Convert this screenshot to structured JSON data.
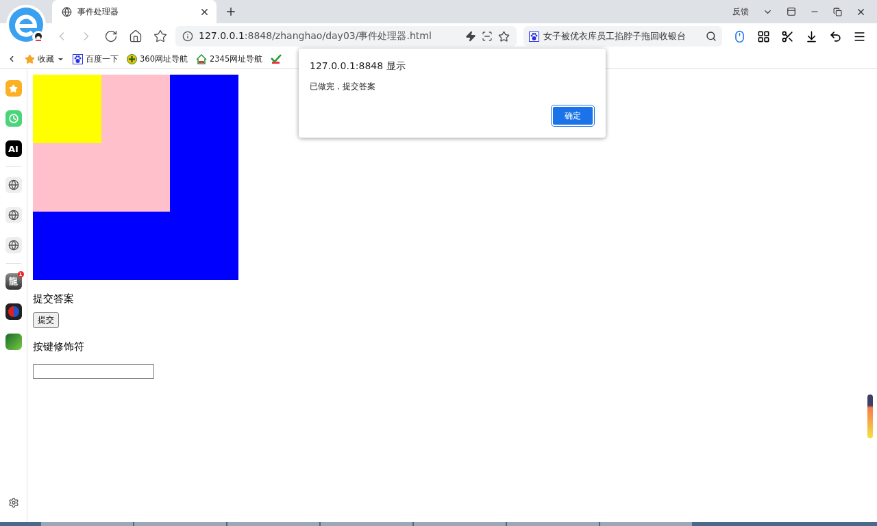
{
  "tab": {
    "title": "事件处理器",
    "selected": true
  },
  "title_bar": {
    "feedback": "反馈"
  },
  "nav_buttons": [
    {
      "kind": "back",
      "disabled": true
    },
    {
      "kind": "forward",
      "disabled": true
    },
    {
      "kind": "reload",
      "disabled": false
    },
    {
      "kind": "home",
      "disabled": false
    },
    {
      "kind": "favorites",
      "disabled": false
    }
  ],
  "address_bar": {
    "host": "127.0.0.1",
    "rest": ":8848/zhanghao/day03/事件处理器.html"
  },
  "search_box": {
    "value": "女子被优衣库员工掐脖子拖回收银台"
  },
  "bookmarks": [
    {
      "kind": "star",
      "label": "收藏"
    },
    {
      "kind": "paw",
      "label": "百度一下"
    },
    {
      "kind": "plus",
      "label": "360网址导航"
    },
    {
      "kind": "house",
      "label": "2345网址导航"
    },
    {
      "kind": "check"
    }
  ],
  "sidebar": [
    {
      "kind": "star"
    },
    {
      "kind": "clock"
    },
    {
      "kind": "text",
      "label": "AI"
    },
    {
      "kind": "divider"
    },
    {
      "kind": "globe"
    },
    {
      "kind": "globe"
    },
    {
      "kind": "globe"
    },
    {
      "kind": "divider"
    },
    {
      "kind": "game",
      "label": "龍",
      "badge": "1"
    },
    {
      "kind": "orb"
    },
    {
      "kind": "green"
    }
  ],
  "page": {
    "heading1": "提交答案",
    "button": "提交",
    "heading2": "按键修饰符"
  },
  "dialog": {
    "title": "127.0.0.1:8848 显示",
    "message": "已做完，提交答案",
    "ok": "确定"
  }
}
